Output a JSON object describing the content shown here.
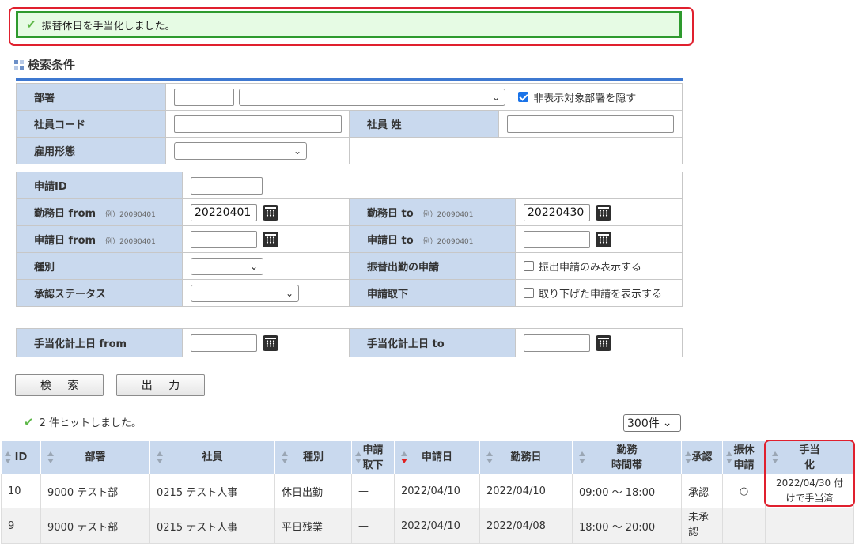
{
  "message": {
    "text": "振替休日を手当化しました。",
    "icon": "check-icon"
  },
  "search": {
    "title": "検索条件",
    "department": {
      "label": "部署",
      "hide_checkbox_label": "非表示対象部署を隠す",
      "hide_checked": true
    },
    "employee_code": {
      "label": "社員コード",
      "value": ""
    },
    "employee_name": {
      "label": "社員 姓",
      "value": ""
    },
    "employment_type": {
      "label": "雇用形態"
    },
    "application_id": {
      "label": "申請ID",
      "value": ""
    },
    "work_date_from": {
      "label": "勤務日 from",
      "example": "例）20090401",
      "value": "20220401"
    },
    "work_date_to": {
      "label": "勤務日 to",
      "example": "例）20090401",
      "value": "20220430"
    },
    "apply_date_from": {
      "label": "申請日 from",
      "example": "例）20090401",
      "value": ""
    },
    "apply_date_to": {
      "label": "申請日 to",
      "example": "例）20090401",
      "value": ""
    },
    "kind": {
      "label": "種別"
    },
    "substitute_work_app": {
      "label": "振替出勤の申請",
      "checkbox_label": "振出申請のみ表示する",
      "checked": false
    },
    "approval_status": {
      "label": "承認ステータス"
    },
    "withdrawal": {
      "label": "申請取下",
      "checkbox_label": "取り下げた申請を表示する",
      "checked": false
    },
    "allowance_from": {
      "label": "手当化計上日 from",
      "value": ""
    },
    "allowance_to": {
      "label": "手当化計上日 to",
      "value": ""
    }
  },
  "buttons": {
    "search": "検 索",
    "export": "出 力"
  },
  "result": {
    "hits_text": "2 件ヒットしました。",
    "per_page": "300件"
  },
  "table": {
    "headers": [
      "ID",
      "部署",
      "社員",
      "種別",
      "申請\n取下",
      "申請日",
      "勤務日",
      "勤務\n時間帯",
      "承認",
      "振休\n申請",
      "手当\n化"
    ],
    "rows": [
      [
        "10",
        "9000 テスト部",
        "0215 テスト人事",
        "休日出勤",
        "—",
        "2022/04/10",
        "2022/04/10",
        "09:00 〜 18:00",
        "承認",
        "○",
        "2022/04/30 付\nけで手当済"
      ],
      [
        "9",
        "9000 テスト部",
        "0215 テスト人事",
        "平日残業",
        "—",
        "2022/04/10",
        "2022/04/08",
        "18:00 〜 20:00",
        "未承\n認",
        "",
        ""
      ]
    ]
  },
  "colors": {
    "accent_blue": "#3e78d0",
    "label_bg": "#c9d9ee",
    "success_border": "#2e9a2e",
    "success_bg": "#e6fbe4",
    "highlight_red": "#e0202e",
    "unapproved_red": "#d01818"
  }
}
